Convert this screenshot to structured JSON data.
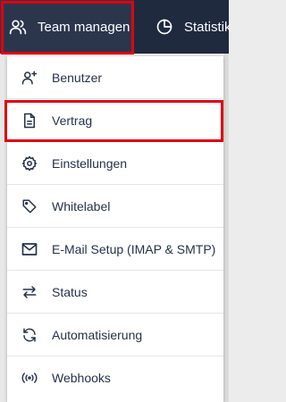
{
  "topbar": {
    "background": "#1f2a3f",
    "tabs": [
      {
        "label": "Team managen",
        "icon": "users-icon"
      },
      {
        "label": "Statistik",
        "icon": "pie-chart-icon"
      }
    ]
  },
  "highlight_color": "#e3000f",
  "menu": {
    "items": [
      {
        "label": "Benutzer",
        "icon": "user-plus-icon"
      },
      {
        "label": "Vertrag",
        "icon": "document-icon"
      },
      {
        "label": "Einstellungen",
        "icon": "gear-icon"
      },
      {
        "label": "Whitelabel",
        "icon": "tag-icon"
      },
      {
        "label": "E-Mail Setup (IMAP & SMTP)",
        "icon": "envelope-icon"
      },
      {
        "label": "Status",
        "icon": "arrows-swap-icon"
      },
      {
        "label": "Automatisierung",
        "icon": "refresh-icon"
      },
      {
        "label": "Webhooks",
        "icon": "broadcast-icon"
      }
    ]
  }
}
